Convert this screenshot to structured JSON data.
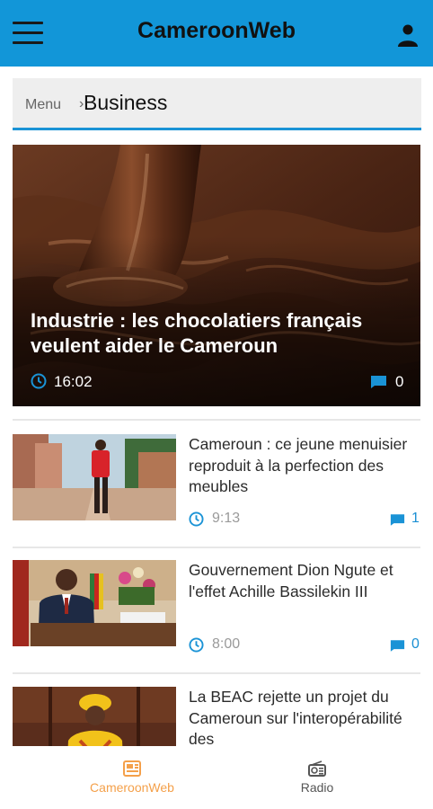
{
  "app": {
    "title": "CameroonWeb",
    "accent_color": "#1296d8",
    "menu_icon": "hamburger-menu-icon",
    "account_icon": "user-account-icon"
  },
  "breadcrumb": {
    "root": "Menu",
    "separator": "›",
    "current": "Business"
  },
  "featured": {
    "title": "Industrie : les chocolatiers français veulent aider le Cameroun",
    "time": "16:02",
    "comments": "0",
    "image": "melted chocolate"
  },
  "articles": [
    {
      "title": "Cameroun : ce jeune menuisier reproduit à la perfection des meubles",
      "time": "9:13",
      "comments": "1",
      "image": "young man in red on a dirt road"
    },
    {
      "title": "Gouvernement Dion Ngute et l'effet Achille Bassilekin III",
      "time": "8:00",
      "comments": "0",
      "image": "man in suit at a desk with flowers"
    },
    {
      "title": "La BEAC rejette un projet du Cameroun sur l'interopérabilité des",
      "time": "",
      "comments": "",
      "image": "woman in yellow headwrap"
    }
  ],
  "bottom_nav": {
    "tabs": [
      {
        "label": "CameroonWeb",
        "icon": "news-icon",
        "active": true,
        "color": "#f4a04a"
      },
      {
        "label": "Radio",
        "icon": "radio-icon",
        "active": false,
        "color": "#555555"
      }
    ]
  }
}
